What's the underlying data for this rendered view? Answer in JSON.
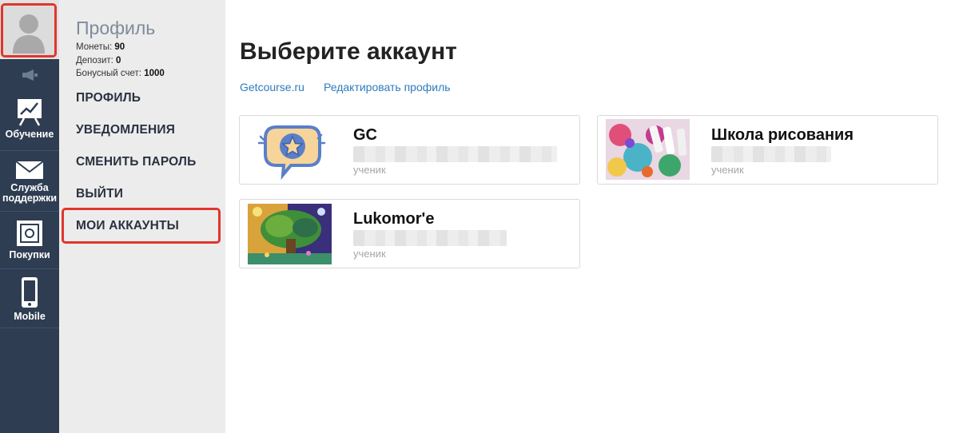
{
  "rail": {
    "items": [
      {
        "label": "Обучение",
        "icon": "presentation-chart-icon"
      },
      {
        "label": "Служба поддержки",
        "icon": "envelope-icon"
      },
      {
        "label": "Покупки",
        "icon": "safe-icon"
      },
      {
        "label": "Mobile",
        "icon": "mobile-phone-icon"
      }
    ]
  },
  "sidebar": {
    "title": "Профиль",
    "stats": [
      {
        "label": "Монеты:",
        "value": "90"
      },
      {
        "label": "Депозит:",
        "value": "0"
      },
      {
        "label": "Бонусный счет:",
        "value": "1000"
      }
    ],
    "menu": [
      "ПРОФИЛЬ",
      "УВЕДОМЛЕНИЯ",
      "СМЕНИТЬ ПАРОЛЬ",
      "ВЫЙТИ",
      "МОИ АККАУНТЫ"
    ],
    "active_item": "МОИ АККАУНТЫ"
  },
  "main": {
    "title": "Выберите аккаунт",
    "links": [
      "Getcourse.ru",
      "Редактировать профиль"
    ],
    "accounts": [
      {
        "name": "GC",
        "role": "ученик"
      },
      {
        "name": "Школа рисования",
        "role": "ученик"
      },
      {
        "name": "Lukomor'e",
        "role": "ученик"
      }
    ]
  },
  "colors": {
    "rail_bg": "#2e3d51",
    "sidebar_bg": "#ececec",
    "highlight_border": "#e0362c",
    "link": "#2f7bbd"
  }
}
